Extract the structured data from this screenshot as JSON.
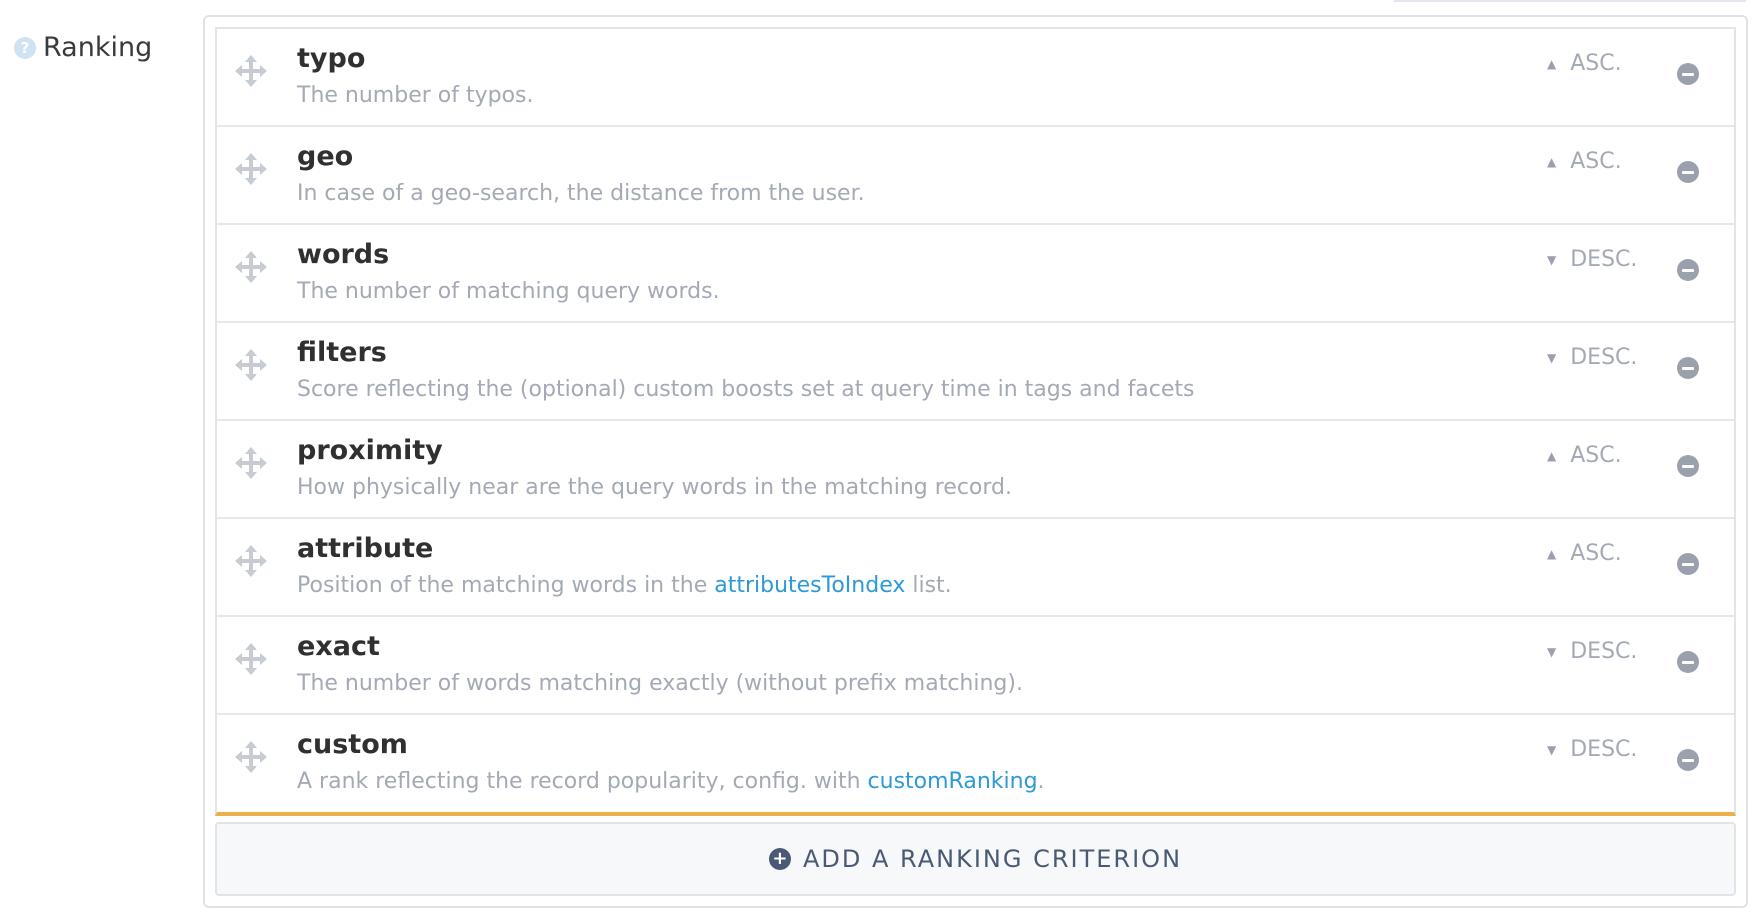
{
  "section": {
    "label": "Ranking",
    "help_icon": "question-circle-icon"
  },
  "criteria": [
    {
      "name": "typo",
      "description": "The number of typos.",
      "order": "ASC.",
      "direction": "up"
    },
    {
      "name": "geo",
      "description": "In case of a geo-search, the distance from the user.",
      "order": "ASC.",
      "direction": "up"
    },
    {
      "name": "words",
      "description": "The number of matching query words.",
      "order": "DESC.",
      "direction": "down"
    },
    {
      "name": "filters",
      "description": "Score reflecting the (optional) custom boosts set at query time in tags and facets",
      "order": "DESC.",
      "direction": "down"
    },
    {
      "name": "proximity",
      "description": "How physically near are the query words in the matching record.",
      "order": "ASC.",
      "direction": "up"
    },
    {
      "name": "attribute",
      "description_before": "Position of the matching words in the ",
      "description_link": "attributesToIndex",
      "description_after": " list.",
      "order": "ASC.",
      "direction": "up"
    },
    {
      "name": "exact",
      "description": "The number of words matching exactly (without prefix matching).",
      "order": "DESC.",
      "direction": "down"
    },
    {
      "name": "custom",
      "description_before": "A rank reflecting the record popularity, config. with ",
      "description_link": "customRanking",
      "description_after": ".",
      "order": "DESC.",
      "direction": "down"
    }
  ],
  "add_button": {
    "label": "ADD A RANKING CRITERION",
    "icon": "plus-circle-icon"
  },
  "colors": {
    "accent_border": "#ecb04b",
    "link": "#2d9ad6",
    "muted_text": "#a4a9b6",
    "button_text": "#4a5a74"
  }
}
